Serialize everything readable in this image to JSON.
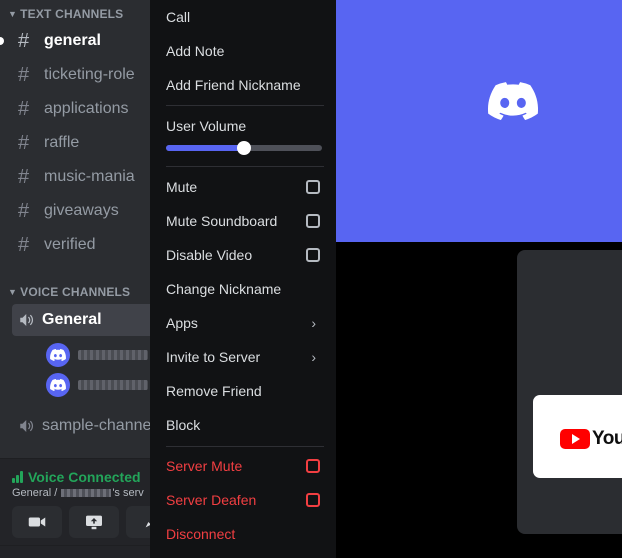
{
  "sidebar": {
    "text_header": "TEXT CHANNELS",
    "text_channels": [
      "general",
      "ticketing-role",
      "applications",
      "raffle",
      "music-mania",
      "giveaways",
      "verified"
    ],
    "voice_header": "VOICE CHANNELS",
    "voice_channels": [
      "General",
      "sample-channel"
    ]
  },
  "voice_panel": {
    "status": "Voice Connected",
    "location_prefix": "General / ",
    "location_suffix": "'s serv"
  },
  "context_menu": {
    "items_top": [
      "Call",
      "Add Note",
      "Add Friend Nickname"
    ],
    "volume_label": "User Volume",
    "volume_level": 0.5,
    "checkbox_items": [
      "Mute",
      "Mute Soundboard",
      "Disable Video"
    ],
    "items_mid": [
      "Change Nickname"
    ],
    "submenu_items": [
      "Apps",
      "Invite to Server"
    ],
    "items_bottom": [
      "Remove Friend",
      "Block"
    ],
    "danger_checkbox_items": [
      "Server Mute",
      "Server Deafen"
    ],
    "danger_items": [
      "Disconnect"
    ]
  },
  "stream": {
    "youtube_text": "You"
  },
  "colors": {
    "blurple": "#5865f2",
    "danger": "#f23f42",
    "voice_green": "#23a55a",
    "menu_bg": "#111214",
    "sidebar_bg": "#2b2d31"
  }
}
